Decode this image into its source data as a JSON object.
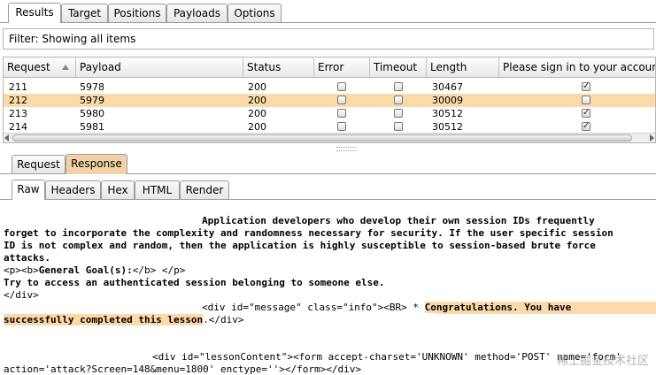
{
  "main_tabs": [
    "Results",
    "Target",
    "Positions",
    "Payloads",
    "Options"
  ],
  "filter": {
    "label": "Filter:",
    "text": "Showing all items"
  },
  "columns": [
    "Request",
    "Payload",
    "Status",
    "Error",
    "Timeout",
    "Length",
    "Please sign in to your account"
  ],
  "rows": [
    {
      "request": "211",
      "payload": "5978",
      "status": "200",
      "error": false,
      "timeout": false,
      "length": "30467",
      "signin": true
    },
    {
      "request": "212",
      "payload": "5979",
      "status": "200",
      "error": false,
      "timeout": false,
      "length": "30009",
      "signin": false,
      "selected": true
    },
    {
      "request": "213",
      "payload": "5980",
      "status": "200",
      "error": false,
      "timeout": false,
      "length": "30512",
      "signin": true
    },
    {
      "request": "214",
      "payload": "5981",
      "status": "200",
      "error": false,
      "timeout": false,
      "length": "30512",
      "signin": true
    }
  ],
  "req_resp_tabs": [
    "Request",
    "Response"
  ],
  "view_tabs": [
    "Raw",
    "Headers",
    "Hex",
    "HTML",
    "Render"
  ],
  "body": {
    "l1": "Application developers who develop their own session IDs frequently",
    "l2": "forget to incorporate the complexity and randomness necessary for security. If the user specific session",
    "l3": "ID is not complex and random, then the application is highly susceptible to session-based brute force",
    "l4": "attacks.",
    "l5_a": "<p><b>",
    "l5_b": "General Goal(s):",
    "l5_c": "</b> </p>",
    "l6": "Try to access an authenticated session belonging to someone else.",
    "l7": "</div>",
    "l8_a": "<div id=\"message\" class=\"info\"><BR> * ",
    "l8_b": "Congratulations. You have",
    "l9_a": "successfully completed this lesson",
    "l9_b": ".</div>",
    "l10": "<div id=\"lessonContent\"><form accept-charset='UNKNOWN' method='POST' name='form'",
    "l11": "action='attack?Screen=148&menu=1800' enctype=''></form></div>"
  },
  "watermark": "稀土掘金技术社区",
  "colors": {
    "selected_row": "#fbd9a8",
    "active_tab_orange": "#f0d2a6"
  }
}
